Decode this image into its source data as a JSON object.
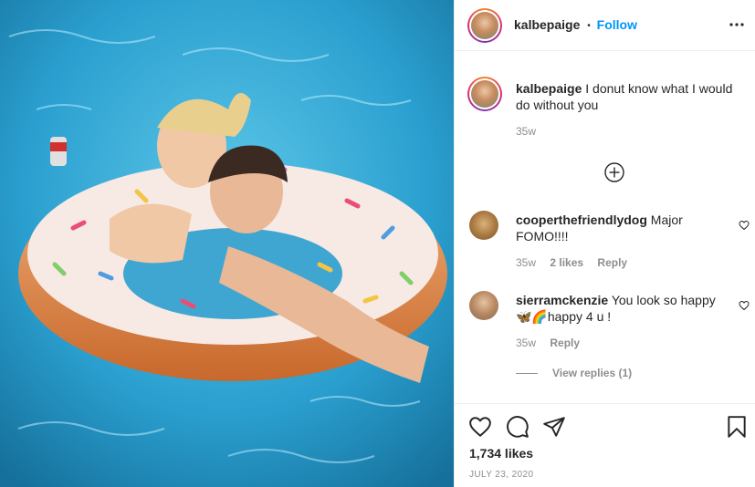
{
  "post": {
    "username": "kalbepaige",
    "follow_separator": "•",
    "follow_label": "Follow"
  },
  "caption": {
    "username": "kalbepaige",
    "text": "I donut know what I would do without you",
    "time": "35w"
  },
  "comments": [
    {
      "username": "cooperthefriendlydog",
      "text": "Major FOMO!!!!",
      "time": "35w",
      "likes": "2 likes",
      "reply_label": "Reply"
    },
    {
      "username": "sierramckenzie",
      "text": "You look so happy 🦋🌈happy 4 u !",
      "time": "35w",
      "reply_label": "Reply",
      "view_replies": "View replies (1)"
    }
  ],
  "footer": {
    "likes": "1,734 likes",
    "date": "JULY 23, 2020"
  },
  "icons": {
    "more": "more-options-icon",
    "add_comment": "plus-circle-icon",
    "like": "heart-icon",
    "comment": "comment-icon",
    "share": "share-icon",
    "save": "bookmark-icon"
  },
  "colors": {
    "accent": "#0095f6",
    "muted": "#8e8e8e",
    "text": "#262626",
    "border": "#efefef"
  }
}
